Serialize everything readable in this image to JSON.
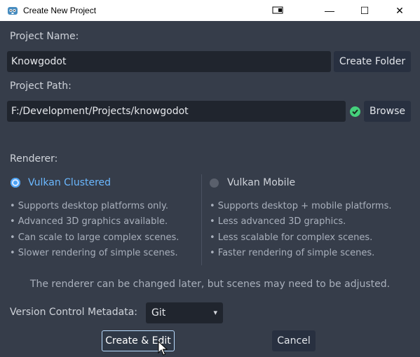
{
  "window": {
    "title": "Create New Project",
    "controls": {
      "minimize": "—",
      "maximize": "☐",
      "close": "✕"
    }
  },
  "project_name": {
    "label": "Project Name:",
    "value": "Knowgodot",
    "create_folder_label": "Create Folder"
  },
  "project_path": {
    "label": "Project Path:",
    "value": "F:/Development/Projects/knowgodot",
    "browse_label": "Browse",
    "status": "valid"
  },
  "renderer": {
    "label": "Renderer:",
    "options": [
      {
        "name": "Vulkan Clustered",
        "selected": true,
        "bullets": [
          "• Supports desktop platforms only.",
          "• Advanced 3D graphics available.",
          "• Can scale to large complex scenes.",
          "• Slower rendering of simple scenes."
        ]
      },
      {
        "name": "Vulkan Mobile",
        "selected": false,
        "bullets": [
          "• Supports desktop + mobile platforms.",
          "• Less advanced 3D graphics.",
          "• Less scalable for complex scenes.",
          "• Faster rendering of simple scenes."
        ]
      }
    ],
    "note": "The renderer can be changed later, but scenes may need to be adjusted."
  },
  "vcs": {
    "label": "Version Control Metadata:",
    "selected": "Git"
  },
  "actions": {
    "create_label": "Create & Edit",
    "cancel_label": "Cancel"
  },
  "colors": {
    "accent": "#4aa3f5",
    "panel_bg": "#363d4a",
    "field_bg": "#20252e",
    "ok": "#45d17c"
  }
}
